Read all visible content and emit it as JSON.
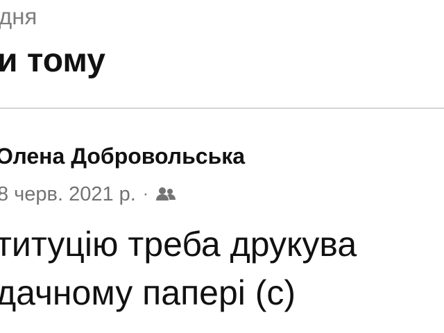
{
  "memory": {
    "date_fragment": "дня",
    "title_fragment": "и тому"
  },
  "post": {
    "author": "Олена Добровольська",
    "date": "8 черв. 2021 р.",
    "separator": "·",
    "audience_icon": "friends-icon",
    "text_lines": [
      "титуцію треба друкува",
      "дачному папері (с)"
    ]
  },
  "colors": {
    "secondary_text": "#737373",
    "divider": "#d4d4d4",
    "primary_text": "#111111"
  }
}
